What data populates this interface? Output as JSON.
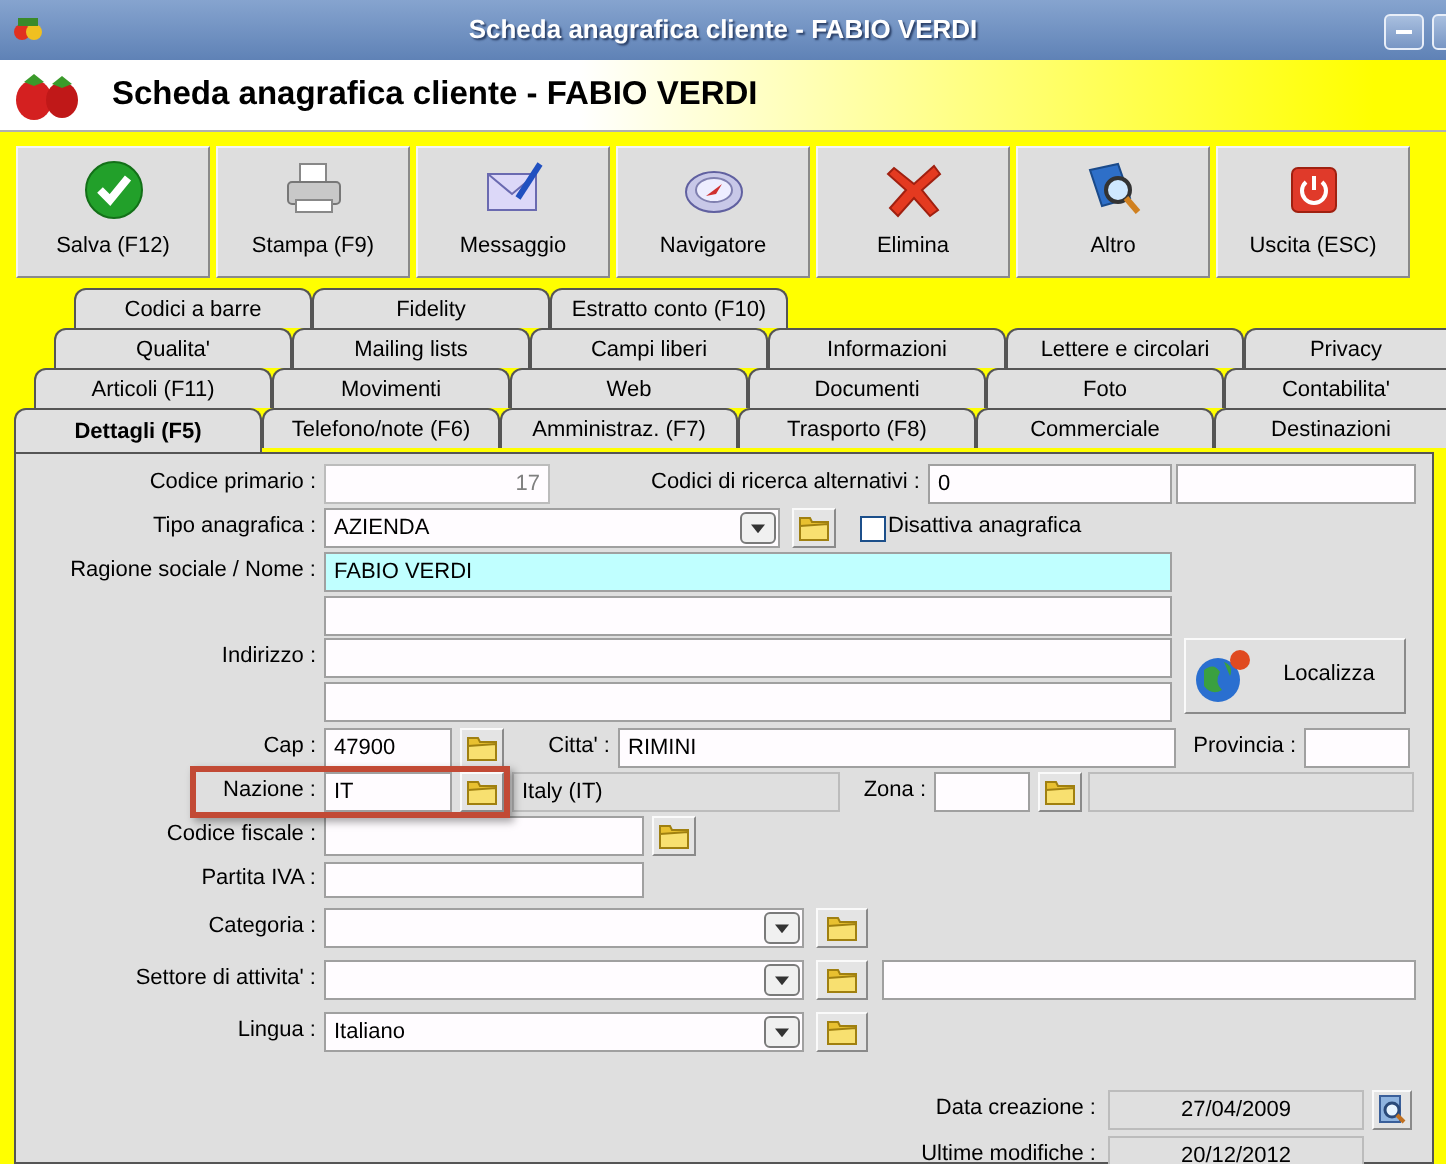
{
  "window": {
    "title": "Scheda anagrafica cliente - FABIO VERDI"
  },
  "header": {
    "title": "Scheda anagrafica cliente - FABIO VERDI"
  },
  "toolbar": [
    {
      "label": "Salva (F12)"
    },
    {
      "label": "Stampa (F9)"
    },
    {
      "label": "Messaggio"
    },
    {
      "label": "Navigatore"
    },
    {
      "label": "Elimina"
    },
    {
      "label": "Altro"
    },
    {
      "label": "Uscita (ESC)"
    }
  ],
  "tab_rows": [
    {
      "tabs": [
        {
          "label": "Codici a barre",
          "selected": false
        },
        {
          "label": "Fidelity",
          "selected": false
        },
        {
          "label": "Estratto conto (F10)",
          "selected": false
        }
      ]
    },
    {
      "tabs": [
        {
          "label": "Qualita'",
          "selected": false
        },
        {
          "label": "Mailing lists",
          "selected": false
        },
        {
          "label": "Campi liberi",
          "selected": false
        },
        {
          "label": "Informazioni",
          "selected": false
        },
        {
          "label": "Lettere e circolari",
          "selected": false
        },
        {
          "label": "Privacy",
          "selected": false
        }
      ]
    },
    {
      "tabs": [
        {
          "label": "Articoli (F11)",
          "selected": false
        },
        {
          "label": "Movimenti",
          "selected": false
        },
        {
          "label": "Web",
          "selected": false
        },
        {
          "label": "Documenti",
          "selected": false
        },
        {
          "label": "Foto",
          "selected": false
        },
        {
          "label": "Contabilita'",
          "selected": false
        }
      ]
    },
    {
      "tabs": [
        {
          "label": "Dettagli (F5)",
          "selected": true
        },
        {
          "label": "Telefono/note (F6)",
          "selected": false
        },
        {
          "label": "Amministraz. (F7)",
          "selected": false
        },
        {
          "label": "Trasporto (F8)",
          "selected": false
        },
        {
          "label": "Commerciale",
          "selected": false
        },
        {
          "label": "Destinazioni",
          "selected": false
        }
      ]
    }
  ],
  "form": {
    "codice_primario": {
      "label": "Codice primario :",
      "value": "17"
    },
    "codici_alternativi": {
      "label": "Codici di ricerca alternativi :",
      "value": "0"
    },
    "tipo_anagrafica": {
      "label": "Tipo anagrafica :",
      "value": "AZIENDA"
    },
    "disattiva": {
      "label": "Disattiva anagrafica",
      "checked": false
    },
    "ragione_sociale": {
      "label": "Ragione sociale / Nome :",
      "value": "FABIO VERDI"
    },
    "indirizzo": {
      "label": "Indirizzo :"
    },
    "localizza": {
      "label": "Localizza"
    },
    "cap": {
      "label": "Cap :",
      "value": "47900"
    },
    "citta": {
      "label": "Citta' :",
      "value": "RIMINI"
    },
    "provincia": {
      "label": "Provincia :"
    },
    "nazione": {
      "label": "Nazione :",
      "value": "IT",
      "description": "Italy (IT)"
    },
    "zona": {
      "label": "Zona :"
    },
    "codice_fiscale": {
      "label": "Codice fiscale :"
    },
    "partita_iva": {
      "label": "Partita IVA :"
    },
    "categoria": {
      "label": "Categoria :"
    },
    "settore": {
      "label": "Settore di attivita' :"
    },
    "lingua": {
      "label": "Lingua :",
      "value": "Italiano"
    },
    "data_creazione": {
      "label": "Data creazione :",
      "value": "27/04/2009"
    },
    "ultime_modifiche": {
      "label": "Ultime modifiche :",
      "value": "20/12/2012"
    }
  }
}
